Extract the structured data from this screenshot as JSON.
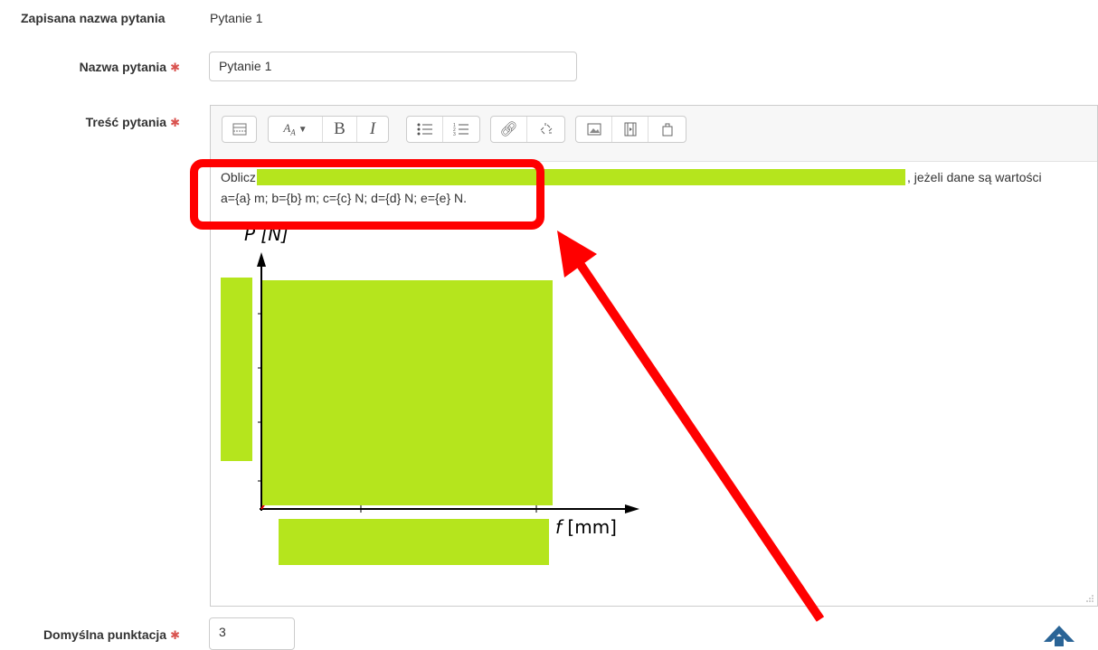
{
  "form": {
    "saved_name_label": "Zapisana nazwa pytania",
    "saved_name_value": "Pytanie 1",
    "name_label": "Nazwa pytania",
    "name_value": "Pytanie 1",
    "text_label": "Treść pytania",
    "required_marker": "✱",
    "default_mark_label": "Domyślna punktacja",
    "default_mark_value": "3"
  },
  "editor": {
    "toolbar_icons": [
      "toolbar-toggle-icon",
      "font-style-icon",
      "bold-icon",
      "italic-icon",
      "unordered-list-icon",
      "ordered-list-icon",
      "link-icon",
      "unlink-icon",
      "image-icon",
      "media-icon",
      "manage-files-icon"
    ],
    "text_start": "Oblicz",
    "text_end": ", jeżeli dane są wartości",
    "text_line2": "a={a} m; b={b} m; c={c} N; d={d} N; e={e} N.",
    "y_axis_label": "P [N]",
    "x_axis_label_var": "f",
    "x_axis_label_unit": "[mm]"
  },
  "colors": {
    "redaction": "#b5e51d",
    "annotation": "#ff0000",
    "required": "#d9534f",
    "scroll_top": "#2a6496"
  },
  "misc": {
    "scroll_top_icon": "arrow-up-icon"
  }
}
